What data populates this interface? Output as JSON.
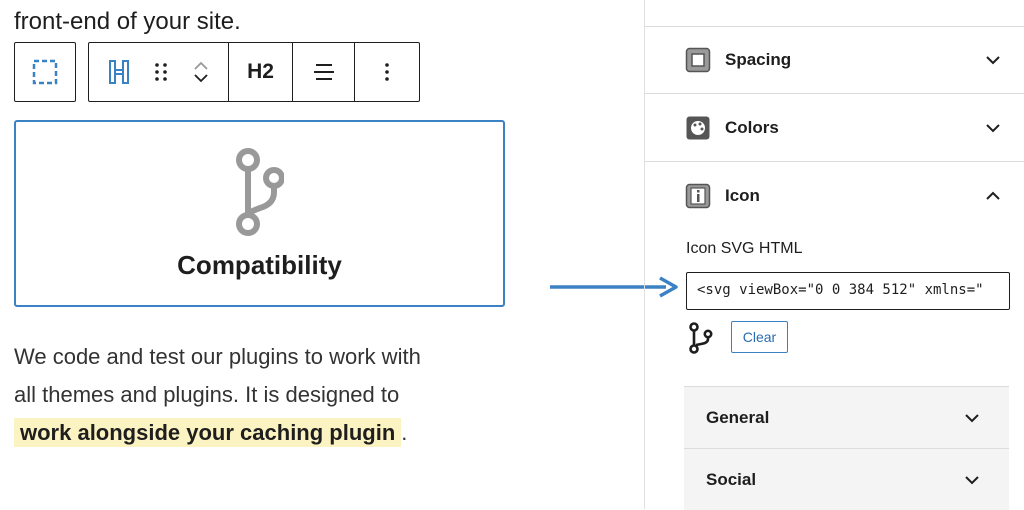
{
  "editor": {
    "top_text": "front-end of your site.",
    "toolbar": {
      "heading_level_label": "H2"
    },
    "block": {
      "title": "Compatibility"
    },
    "paragraph": {
      "text_line1": "We code and test our plugins to work with",
      "text_line2": "all themes and plugins. It is designed to",
      "highlight": "work alongside your caching plugin",
      "period": "."
    }
  },
  "sidebar": {
    "panels": [
      {
        "label": "Spacing",
        "icon": "spacing-icon",
        "expanded": false
      },
      {
        "label": "Colors",
        "icon": "colors-icon",
        "expanded": false
      },
      {
        "label": "Icon",
        "icon": "info-icon",
        "expanded": true
      }
    ],
    "icon_panel": {
      "field_label": "Icon SVG HTML",
      "field_value": "<svg viewBox=\"0 0 384 512\" xmlns=\"",
      "clear_label": "Clear"
    },
    "subpanels": [
      {
        "label": "General"
      },
      {
        "label": "Social"
      }
    ]
  },
  "colors": {
    "accent": "#3b82c4",
    "highlight": "#fcf3c2",
    "arrow": "#3b82c4"
  }
}
